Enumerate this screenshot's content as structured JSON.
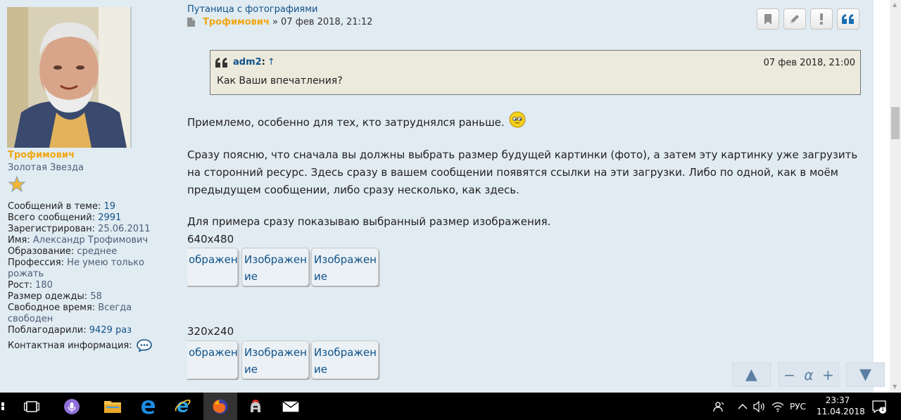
{
  "profile": {
    "username": "Трофимович",
    "rank": "Золотая Звезда",
    "fields": [
      {
        "label": "Сообщений в теме: ",
        "value": "19",
        "link": true
      },
      {
        "label": "Всего сообщений: ",
        "value": "2991",
        "link": true
      },
      {
        "label": "Зарегистрирован: ",
        "value": "25.06.2011",
        "link": false
      },
      {
        "label": "Имя: ",
        "value": "Александр Трофимович",
        "link": false
      },
      {
        "label": "Образование: ",
        "value": "среднее",
        "link": false
      },
      {
        "label": "Профессия: ",
        "value": "Не умею только рожать",
        "link": false
      },
      {
        "label": "Рост: ",
        "value": "180",
        "link": false
      },
      {
        "label": "Размер одежды: ",
        "value": "58",
        "link": false
      },
      {
        "label": "Свободное время: ",
        "value": "Всегда свободен",
        "link": false
      },
      {
        "label": "Поблагодарили: ",
        "value": "9429 раз",
        "link": true
      }
    ],
    "contact_label": "Контактная информация:"
  },
  "post": {
    "title": "Путаница с фотографиями",
    "author": "Трофимович",
    "date": "» 07 фев 2018, 21:12",
    "quote": {
      "author": "adm2",
      "colon": ":",
      "arrow": "↑",
      "date": "07 фев 2018, 21:00",
      "text": "Как Ваши впечатления?"
    },
    "paragraph1": "Приемлемо, особенно для тех, кто затруднялся раньше.",
    "paragraph2": "Сразу поясню, что сначала вы должны выбрать размер будущей картинки (фото), а затем эту картинку уже загрузить на сторонний ресурс. Здесь сразу в вашем сообщении появятся ссылки на эти загрузки. Либо по одной, как в моём предыдущем сообщении, либо сразу несколько, как здесь.",
    "paragraph3": "Для примера сразу показываю выбранный размер изображения.",
    "size1": "640x480",
    "size2": "320x240",
    "thumb_label_partial": "ображен",
    "thumb_label": "Изображение"
  },
  "nav": {
    "up": "▲",
    "minus": "−",
    "alpha": "α",
    "plus": "+",
    "down": "▼"
  },
  "taskbar": {
    "language": "РУС",
    "time": "23:37",
    "date": "11.04.2018",
    "notifications": "1"
  },
  "colors": {
    "accent_blue": "#105289",
    "username_orange": "#f0a814",
    "post_bg": "#e1ebf2",
    "quote_bg": "#ebeadd"
  }
}
